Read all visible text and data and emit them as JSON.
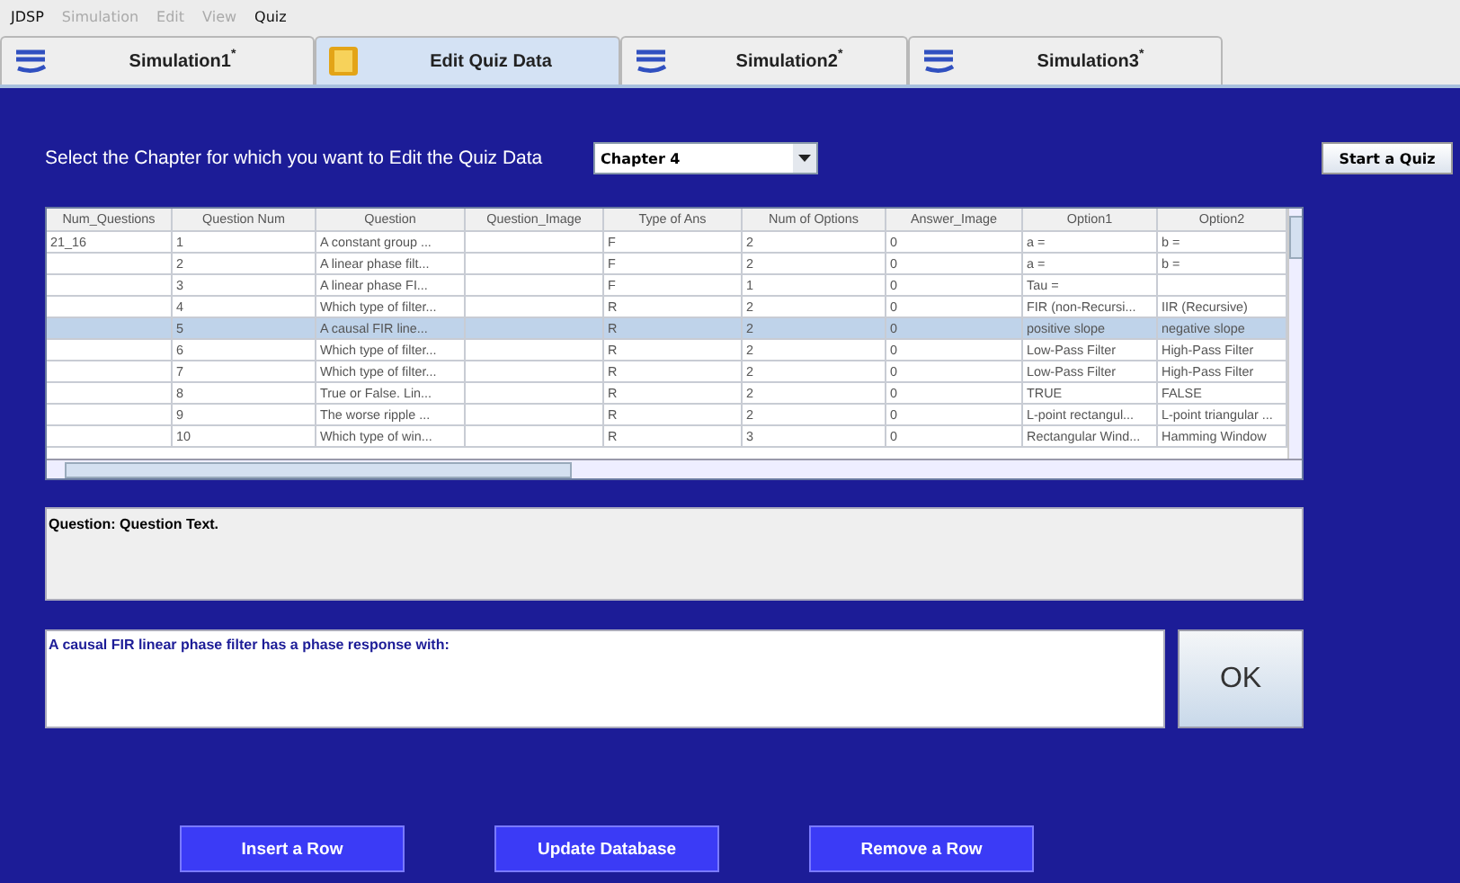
{
  "menu": [
    {
      "label": "JDSP",
      "disabled": false
    },
    {
      "label": "Simulation",
      "disabled": true
    },
    {
      "label": "Edit",
      "disabled": true
    },
    {
      "label": "View",
      "disabled": true
    },
    {
      "label": "Quiz",
      "disabled": false
    }
  ],
  "tabs": [
    {
      "label": "Simulation1",
      "badge": "*",
      "kind": "simulation",
      "selected": false
    },
    {
      "label": "Edit Quiz Data",
      "kind": "editor",
      "selected": true
    },
    {
      "label": "Simulation2",
      "badge": "*",
      "kind": "simulation",
      "selected": false
    },
    {
      "label": "Simulation3",
      "badge": "*",
      "kind": "simulation",
      "selected": false
    }
  ],
  "chapter_prompt": "Select the Chapter for which you want to Edit the Quiz Data",
  "chapter_select": {
    "value": "Chapter 4"
  },
  "start_button": "Start a Quiz",
  "table": {
    "columns": [
      "Num_Questions",
      "Question Num",
      "Question",
      "Question_Image",
      "Type of Ans",
      "Num of Options",
      "Answer_Image",
      "Option1",
      "Option2"
    ],
    "rows": [
      {
        "cells": [
          "21_16",
          "1",
          "A constant group ...",
          "",
          "F",
          "2",
          "0",
          "a =",
          "b ="
        ],
        "selected": false
      },
      {
        "cells": [
          "",
          "2",
          "A linear phase filt...",
          "",
          "F",
          "2",
          "0",
          "a =",
          "b ="
        ],
        "selected": false
      },
      {
        "cells": [
          "",
          "3",
          "A linear phase FI...",
          "",
          "F",
          "1",
          "0",
          "Tau =",
          ""
        ],
        "selected": false
      },
      {
        "cells": [
          "",
          "4",
          "Which type of filter...",
          "",
          "R",
          "2",
          "0",
          "FIR (non-Recursi...",
          "IIR (Recursive)"
        ],
        "selected": false
      },
      {
        "cells": [
          "",
          "5",
          "A causal FIR line...",
          "",
          "R",
          "2",
          "0",
          "positive slope",
          "negative slope"
        ],
        "selected": true
      },
      {
        "cells": [
          "",
          "6",
          "Which type of filter...",
          "",
          "R",
          "2",
          "0",
          "Low-Pass Filter",
          "High-Pass Filter"
        ],
        "selected": false
      },
      {
        "cells": [
          "",
          "7",
          "Which type of filter...",
          "",
          "R",
          "2",
          "0",
          "Low-Pass Filter",
          "High-Pass Filter"
        ],
        "selected": false
      },
      {
        "cells": [
          "",
          "8",
          "True or False. Lin...",
          "",
          "R",
          "2",
          "0",
          "TRUE",
          "FALSE"
        ],
        "selected": false
      },
      {
        "cells": [
          "",
          "9",
          "The worse ripple ...",
          "",
          "R",
          "2",
          "0",
          "L-point rectangul...",
          "L-point triangular ..."
        ],
        "selected": false
      },
      {
        "cells": [
          "",
          "10",
          "Which type of win...",
          "",
          "R",
          "3",
          "0",
          "Rectangular Wind...",
          "Hamming Window"
        ],
        "selected": false
      }
    ]
  },
  "question_label": "Question: Question Text.",
  "answer_text": {
    "value": "A causal FIR linear phase filter has a phase response with:"
  },
  "ok_button": "OK",
  "actions": [
    "Insert a Row",
    "Update Database",
    "Remove a Row"
  ]
}
